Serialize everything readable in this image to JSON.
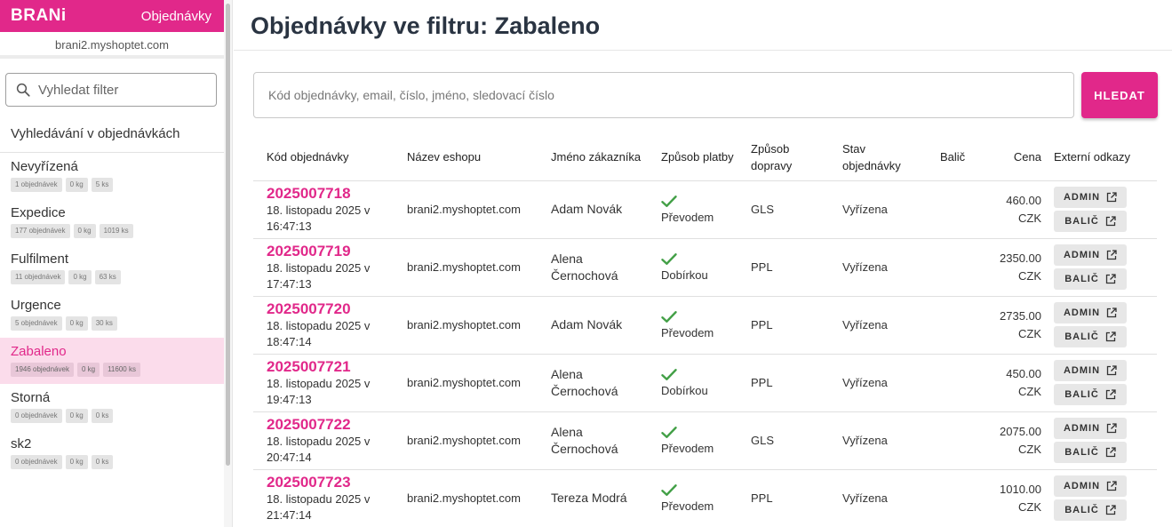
{
  "sidebar": {
    "logo": "BRANi",
    "app_title": "Objednávky",
    "domain": "brani2.myshoptet.com",
    "search_placeholder": "Vyhledat filter",
    "section_title": "Vyhledávání v objednávkách",
    "filters": [
      {
        "name": "Nevyřízená",
        "orders": "1 objednávek",
        "weight": "0 kg",
        "pieces": "5 ks",
        "active": false
      },
      {
        "name": "Expedice",
        "orders": "177 objednávek",
        "weight": "0 kg",
        "pieces": "1019 ks",
        "active": false
      },
      {
        "name": "Fulfilment",
        "orders": "11 objednávek",
        "weight": "0 kg",
        "pieces": "63 ks",
        "active": false
      },
      {
        "name": "Urgence",
        "orders": "5 objednávek",
        "weight": "0 kg",
        "pieces": "30 ks",
        "active": false
      },
      {
        "name": "Zabaleno",
        "orders": "1946 objednávek",
        "weight": "0 kg",
        "pieces": "11600 ks",
        "active": true
      },
      {
        "name": "Storná",
        "orders": "0 objednávek",
        "weight": "0 kg",
        "pieces": "0 ks",
        "active": false
      },
      {
        "name": "sk2",
        "orders": "0 objednávek",
        "weight": "0 kg",
        "pieces": "0 ks",
        "active": false
      }
    ]
  },
  "main": {
    "title": "Objednávky ve filtru: Zabaleno",
    "search_placeholder": "Kód objednávky, email, číslo, jméno, sledovací číslo",
    "search_button": "HLEDAT",
    "columns": {
      "code": "Kód objednávky",
      "eshop": "Název eshopu",
      "customer": "Jméno zákazníka",
      "payment": "Způsob platby",
      "shipping": "Způsob dopravy",
      "status": "Stav objednávky",
      "packer": "Balič",
      "price": "Cena",
      "links": "Externí odkazy"
    },
    "admin_label": "ADMIN",
    "packer_label": "BALIČ",
    "orders": [
      {
        "code": "2025007718",
        "date": "18. listopadu 2025 v 16:47:13",
        "eshop": "brani2.myshoptet.com",
        "customer": "Adam Novák",
        "payment": "Převodem",
        "shipping": "GLS",
        "status": "Vyřízena",
        "packer": "",
        "price": "460.00",
        "currency": "CZK"
      },
      {
        "code": "2025007719",
        "date": "18. listopadu 2025 v 17:47:13",
        "eshop": "brani2.myshoptet.com",
        "customer": "Alena Černochová",
        "payment": "Dobírkou",
        "shipping": "PPL",
        "status": "Vyřízena",
        "packer": "",
        "price": "2350.00",
        "currency": "CZK"
      },
      {
        "code": "2025007720",
        "date": "18. listopadu 2025 v 18:47:14",
        "eshop": "brani2.myshoptet.com",
        "customer": "Adam Novák",
        "payment": "Převodem",
        "shipping": "PPL",
        "status": "Vyřízena",
        "packer": "",
        "price": "2735.00",
        "currency": "CZK"
      },
      {
        "code": "2025007721",
        "date": "18. listopadu 2025 v 19:47:13",
        "eshop": "brani2.myshoptet.com",
        "customer": "Alena Černochová",
        "payment": "Dobírkou",
        "shipping": "PPL",
        "status": "Vyřízena",
        "packer": "",
        "price": "450.00",
        "currency": "CZK"
      },
      {
        "code": "2025007722",
        "date": "18. listopadu 2025 v 20:47:14",
        "eshop": "brani2.myshoptet.com",
        "customer": "Alena Černochová",
        "payment": "Převodem",
        "shipping": "GLS",
        "status": "Vyřízena",
        "packer": "",
        "price": "2075.00",
        "currency": "CZK"
      },
      {
        "code": "2025007723",
        "date": "18. listopadu 2025 v 21:47:14",
        "eshop": "brani2.myshoptet.com",
        "customer": "Tereza Modrá",
        "payment": "Převodem",
        "shipping": "PPL",
        "status": "Vyřízena",
        "packer": "",
        "price": "1010.00",
        "currency": "CZK"
      }
    ]
  },
  "colors": {
    "brand": "#e1288a",
    "active_filter_bg": "#fbdceb",
    "check": "#43a047",
    "title": "#2a3442"
  },
  "icons": {
    "search": "search-icon",
    "check": "check-icon",
    "external": "external-link-icon"
  }
}
